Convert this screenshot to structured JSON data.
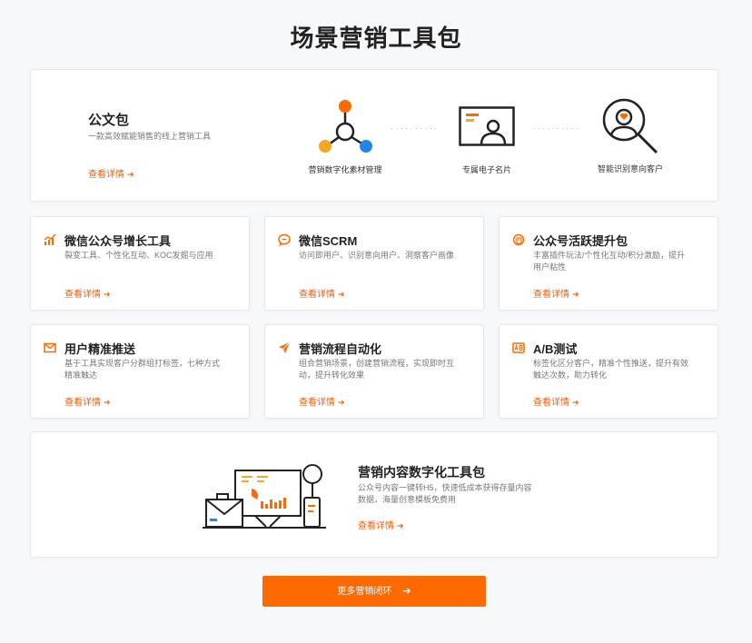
{
  "page_title": "场景营销工具包",
  "hero": {
    "title": "公文包",
    "desc": "一款高效赋能销售的线上营销工具",
    "link": "查看详情",
    "steps": [
      "营销数字化素材管理",
      "专属电子名片",
      "智能识别意向客户"
    ],
    "dots": "··········"
  },
  "cards": [
    {
      "title": "微信公众号增长工具",
      "desc": "裂变工具、个性化互动、KOC发掘与应用",
      "link": "查看详情",
      "icon": "growth-chart-icon"
    },
    {
      "title": "微信SCRM",
      "desc": "访问即用户、识别意向用户、洞察客户画像",
      "link": "查看详情",
      "icon": "chat-bubble-icon"
    },
    {
      "title": "公众号活跃提升包",
      "desc": "丰富插件玩法/个性化互动/积分激励，提升用户粘性",
      "link": "查看详情",
      "icon": "activity-package-icon"
    },
    {
      "title": "用户精准推送",
      "desc": "基于工具实现客户分群组打标签，七种方式精准触达",
      "link": "查看详情",
      "icon": "mail-push-icon"
    },
    {
      "title": "营销流程自动化",
      "desc": "组合营销场景，创建营销流程，实现即时互动，提升转化效果",
      "link": "查看详情",
      "icon": "paper-plane-icon"
    },
    {
      "title": "A/B测试",
      "desc": "标签化区分客户，精准个性推送，提升有效触达次数，助力转化",
      "link": "查看详情",
      "icon": "ab-test-icon"
    }
  ],
  "bottom": {
    "title": "营销内容数字化工具包",
    "desc": "公众号内容一键转H5，快速低成本获得存量内容数据，海量创意模板免费用",
    "link": "查看详情"
  },
  "cta": "更多营销闭环",
  "arrow": "➔",
  "colors": {
    "accent": "#ff6a00",
    "link": "#f25c05",
    "blue": "#1e88e5",
    "yellow": "#f5a623"
  }
}
